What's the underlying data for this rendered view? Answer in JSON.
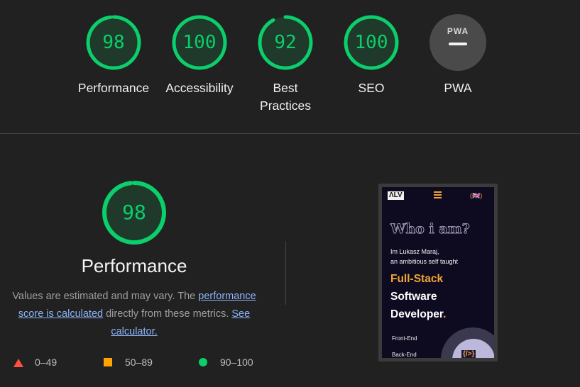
{
  "colors": {
    "pass": "#0cce6b",
    "average": "#ffa400",
    "fail": "#ff4e42",
    "link": "#8ab4f8",
    "background": "#212121"
  },
  "categories": [
    {
      "name": "Performance",
      "score": 98
    },
    {
      "name": "Accessibility",
      "score": 100
    },
    {
      "name": "Best Practices",
      "score": 92
    },
    {
      "name": "SEO",
      "score": 100
    },
    {
      "name": "PWA",
      "mini": "PWA",
      "icon": "pwa-dash-icon"
    }
  ],
  "detail": {
    "score": 98,
    "title": "Performance",
    "text1": "Values are estimated and may vary. The ",
    "link1": "performance score is calculated",
    "text2": " directly from these metrics. ",
    "link2": "See calculator."
  },
  "legend": [
    {
      "shape": "triangle",
      "range": "0–49"
    },
    {
      "shape": "square",
      "range": "50–89"
    },
    {
      "shape": "circle",
      "range": "90–100"
    }
  ],
  "preview": {
    "logo": "ΛLV",
    "lang": "(🇬🇧)",
    "heading": "Who i am?",
    "intro_line1": "Im Lukasz Maraj,",
    "intro_line2": "an ambitious self taught",
    "headline1": "Full-Stack",
    "headline2": "Software",
    "headline3": "Developer",
    "headline3_dot": ".",
    "skill1": "Front-End",
    "skill2": "Back-End",
    "badge": "{/>}"
  }
}
